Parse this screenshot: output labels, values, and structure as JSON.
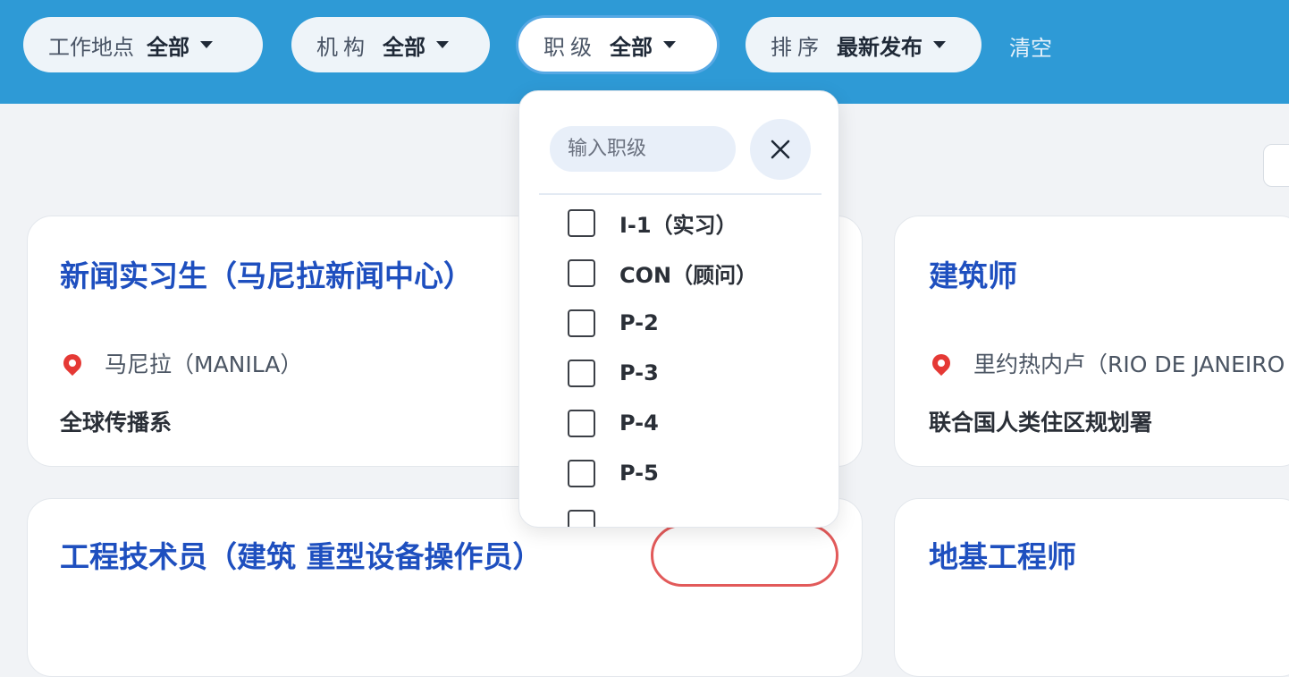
{
  "filters": [
    {
      "label": "工作地点",
      "value": "全部"
    },
    {
      "label": "机构",
      "value": "全部"
    },
    {
      "label": "职级",
      "value": "全部"
    },
    {
      "label": "排序",
      "value": "最新发布"
    }
  ],
  "clear_label": "清空",
  "jobs": [
    {
      "title": "新闻实习生（马尼拉新闻中心）",
      "location": "马尼拉（MANILA）",
      "org": "全球传播系"
    },
    {
      "title": "建筑师",
      "location": "里约热内卢（RIO DE JANEIRO",
      "org": "联合国人类住区规划署"
    },
    {
      "title": "工程技术员（建筑  重型设备操作员）"
    },
    {
      "title": "地基工程师"
    }
  ],
  "grade_dropdown": {
    "search_placeholder": "输入职级",
    "options": [
      "I-1（实习）",
      "CON（顾问）",
      "P-2",
      "P-3",
      "P-4",
      "P-5"
    ]
  },
  "colors": {
    "header_blue": "#2e9ad6",
    "title_blue": "#1e4fbf",
    "badge_red": "#e25a5a"
  }
}
